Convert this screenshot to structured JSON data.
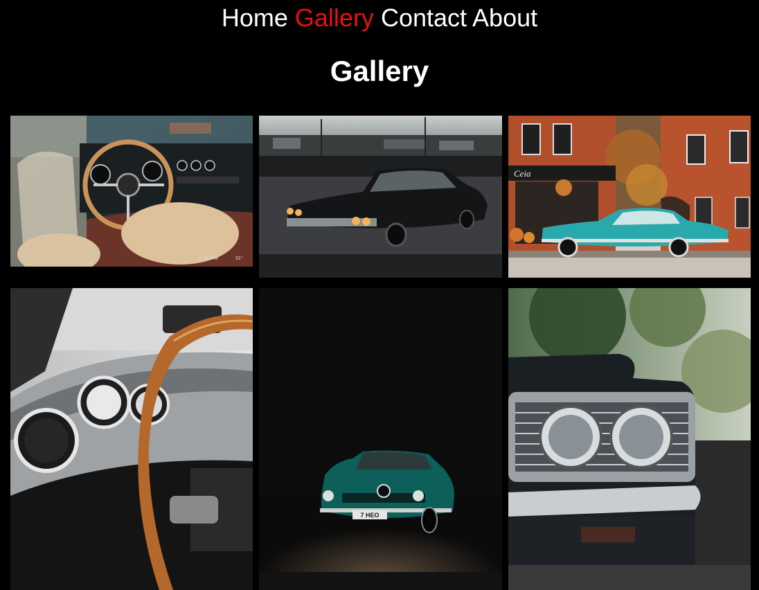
{
  "nav": {
    "items": [
      {
        "label": "Home",
        "active": false
      },
      {
        "label": "Gallery",
        "active": true
      },
      {
        "label": "Contact",
        "active": false
      },
      {
        "label": "About",
        "active": false
      }
    ],
    "active_color": "#e8110f"
  },
  "page_title": "Gallery",
  "gallery": {
    "photos": [
      {
        "subject": "vintage convertible interior with wooden steering wheel and cream leather seats",
        "overlay_time": "12:48 PM",
        "overlay_temp": "31°"
      },
      {
        "subject": "black classic sedan on wet street"
      },
      {
        "subject": "teal classic car parked in front of red brick buildings",
        "shop_sign": "Ceia"
      },
      {
        "subject": "vintage dashboard gauges and wooden steering wheel"
      },
      {
        "subject": "green Mercedes roadster in dark garage",
        "plate": "7 HEO"
      },
      {
        "subject": "chrome front headlights of classic car"
      }
    ]
  }
}
